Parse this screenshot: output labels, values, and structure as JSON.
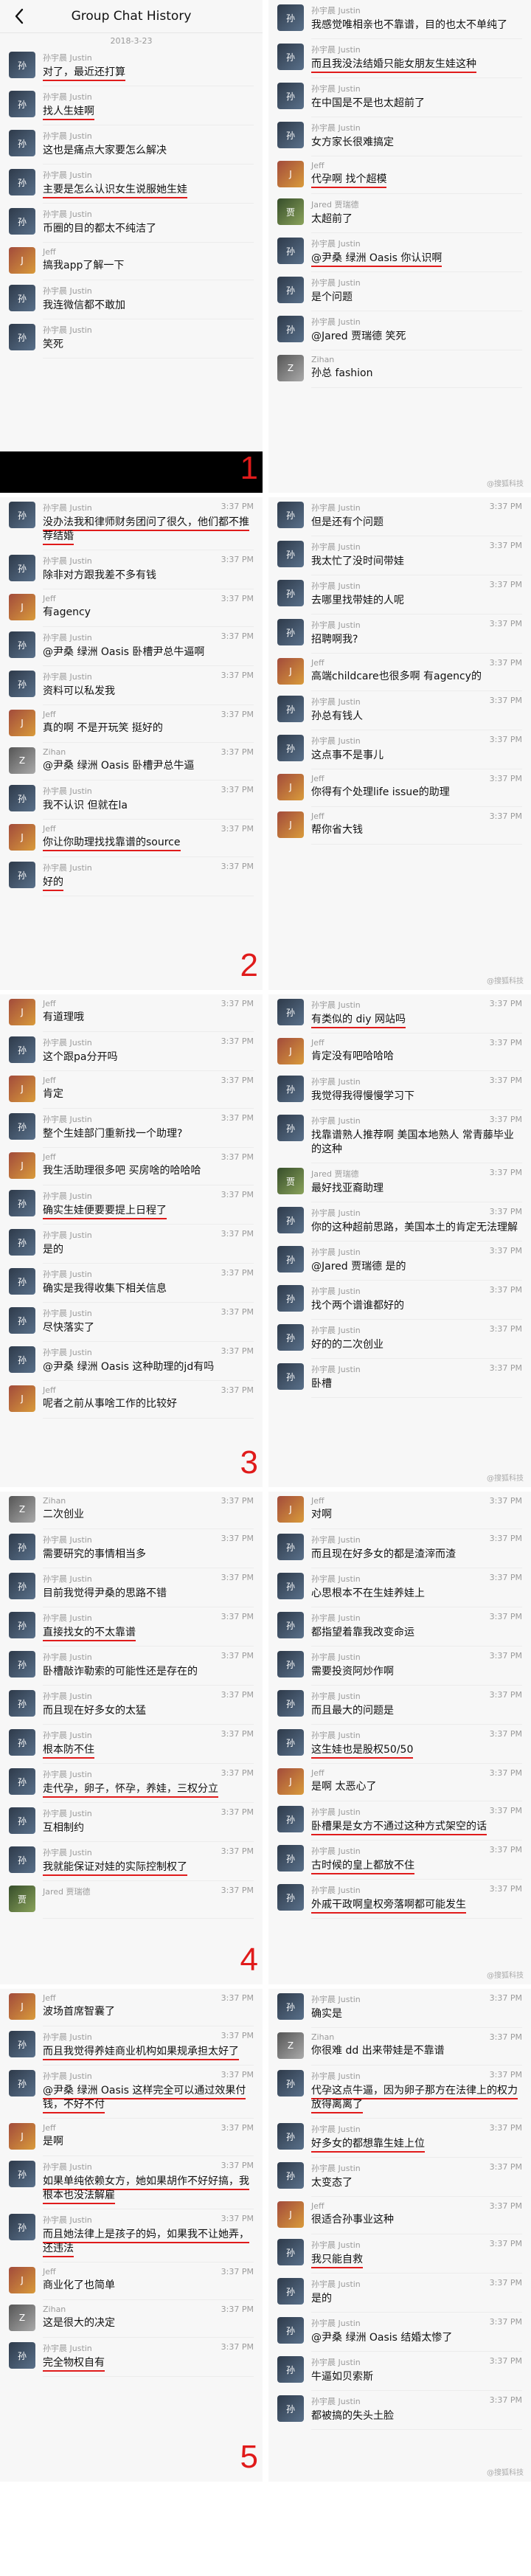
{
  "header": {
    "title": "Group Chat History",
    "date": "2018-3-23",
    "back_icon": "chevron-left-icon"
  },
  "watermark": "@搜狐科技",
  "users": {
    "justin": "孙宇晨 Justin",
    "jeff": "Jeff",
    "zihan": "Zihan",
    "jared": "Jared 贾瑞德",
    "jaredb": "Jared 贾瑞德"
  },
  "left_blocks": [
    {
      "number": "1",
      "show_header": true,
      "black_bar": true,
      "messages": [
        {
          "u": "justin",
          "t": "对了，最近还打算",
          "time": "",
          "ul": true
        },
        {
          "u": "justin",
          "t": "找人生娃啊",
          "time": "",
          "ul": true
        },
        {
          "u": "justin",
          "t": "这也是痛点大家要怎么解决",
          "time": "",
          "ul": false
        },
        {
          "u": "justin",
          "t": "主要是怎么认识女生说服她生娃",
          "time": "",
          "ul": true
        },
        {
          "u": "justin",
          "t": "币圈的目的都太不纯洁了",
          "time": "",
          "ul": false
        },
        {
          "u": "jeff",
          "t": "搞我app了解一下",
          "time": "",
          "ul": false
        },
        {
          "u": "justin",
          "t": "我连微信都不敢加",
          "time": "",
          "ul": false
        },
        {
          "u": "justin",
          "t": "笑死",
          "time": "",
          "ul": false
        }
      ]
    },
    {
      "number": "2",
      "show_header": false,
      "black_bar": false,
      "messages": [
        {
          "u": "justin",
          "t": "没办法我和律师财务团问了很久，他们都不推荐结婚",
          "time": "3:37 PM",
          "ul": true
        },
        {
          "u": "justin",
          "t": "除非对方跟我差不多有钱",
          "time": "3:37 PM",
          "ul": false
        },
        {
          "u": "jeff",
          "t": "有agency",
          "time": "3:37 PM",
          "ul": false
        },
        {
          "u": "justin",
          "t": "@尹桑 绿洲 Oasis 卧槽尹总牛逼啊",
          "time": "3:37 PM",
          "ul": false
        },
        {
          "u": "justin",
          "t": "资料可以私发我",
          "time": "3:37 PM",
          "ul": false
        },
        {
          "u": "jeff",
          "t": "真的啊 不是开玩笑 挺好的",
          "time": "3:37 PM",
          "ul": false
        },
        {
          "u": "zihan",
          "t": "@尹桑 绿洲 Oasis 卧槽尹总牛逼",
          "time": "3:37 PM",
          "ul": false
        },
        {
          "u": "justin",
          "t": "我不认识 但就在la",
          "time": "3:37 PM",
          "ul": false
        },
        {
          "u": "jeff",
          "t": "你让你助理找找靠谱的source",
          "time": "3:37 PM",
          "ul": true
        },
        {
          "u": "justin",
          "t": "好的",
          "time": "3:37 PM",
          "ul": true
        }
      ]
    },
    {
      "number": "3",
      "show_header": false,
      "black_bar": false,
      "messages": [
        {
          "u": "jeff",
          "t": "有道理哦",
          "time": "3:37 PM",
          "ul": false
        },
        {
          "u": "justin",
          "t": "这个跟pa分开吗",
          "time": "3:37 PM",
          "ul": false
        },
        {
          "u": "jeff",
          "t": "肯定",
          "time": "3:37 PM",
          "ul": false
        },
        {
          "u": "justin",
          "t": "整个生娃部门重新找一个助理?",
          "time": "3:37 PM",
          "ul": false
        },
        {
          "u": "jeff",
          "t": "我生活助理很多吧 买房啥的哈哈哈",
          "time": "3:37 PM",
          "ul": false
        },
        {
          "u": "justin",
          "t": "确实生娃便要要提上日程了",
          "time": "3:37 PM",
          "ul": true
        },
        {
          "u": "justin",
          "t": "是的",
          "time": "3:37 PM",
          "ul": false
        },
        {
          "u": "justin",
          "t": "确实是我得收集下相关信息",
          "time": "3:37 PM",
          "ul": false
        },
        {
          "u": "justin",
          "t": "尽快落实了",
          "time": "3:37 PM",
          "ul": false
        },
        {
          "u": "justin",
          "t": "@尹桑 绿洲 Oasis 这种助理的jd有吗",
          "time": "3:37 PM",
          "ul": false
        },
        {
          "u": "jeff",
          "t": "呢者之前从事啥工作的比较好",
          "time": "3:37 PM",
          "ul": false
        }
      ]
    },
    {
      "number": "4",
      "show_header": false,
      "black_bar": false,
      "messages": [
        {
          "u": "zihan",
          "t": "二次创业",
          "time": "3:37 PM",
          "ul": false
        },
        {
          "u": "justin",
          "t": "需要研究的事情相当多",
          "time": "3:37 PM",
          "ul": false
        },
        {
          "u": "justin",
          "t": "目前我觉得尹桑的思路不错",
          "time": "3:37 PM",
          "ul": false
        },
        {
          "u": "justin",
          "t": "直接找女的不太靠谱",
          "time": "3:37 PM",
          "ul": true
        },
        {
          "u": "justin",
          "t": "卧槽敲诈勒索的可能性还是存在的",
          "time": "3:37 PM",
          "ul": false
        },
        {
          "u": "justin",
          "t": "而且现在好多女的太猛",
          "time": "3:37 PM",
          "ul": false
        },
        {
          "u": "justin",
          "t": "根本防不住",
          "time": "3:37 PM",
          "ul": true
        },
        {
          "u": "justin",
          "t": "走代孕，卵子，怀孕，养娃，三权分立",
          "time": "3:37 PM",
          "ul": true
        },
        {
          "u": "justin",
          "t": "互相制约",
          "time": "3:37 PM",
          "ul": false
        },
        {
          "u": "justin",
          "t": "我就能保证对娃的实际控制权了",
          "time": "3:37 PM",
          "ul": true
        },
        {
          "u": "jared",
          "t": "",
          "time": "3:37 PM",
          "ul": false
        }
      ]
    },
    {
      "number": "5",
      "show_header": false,
      "black_bar": false,
      "messages": [
        {
          "u": "jeff",
          "t": "波场首席智囊了",
          "time": "3:37 PM",
          "ul": false
        },
        {
          "u": "justin",
          "t": "而且我觉得养娃商业机构如果规承担太好了",
          "time": "3:37 PM",
          "ul": true
        },
        {
          "u": "justin",
          "t": "@尹桑 绿洲 Oasis 这样完全可以通过效果付钱，不好不付",
          "time": "3:37 PM",
          "ul": true
        },
        {
          "u": "jeff",
          "t": "是啊",
          "time": "3:37 PM",
          "ul": false
        },
        {
          "u": "justin",
          "t": "如果单纯依赖女方，她如果胡作不好好搞，我根本也没法解雇",
          "time": "3:37 PM",
          "ul": true
        },
        {
          "u": "justin",
          "t": "而且她法律上是孩子的妈，如果我不让她弄，还违法",
          "time": "3:37 PM",
          "ul": true
        },
        {
          "u": "jeff",
          "t": "商业化了也简单",
          "time": "3:37 PM",
          "ul": false
        },
        {
          "u": "zihan",
          "t": "这是很大的决定",
          "time": "3:37 PM",
          "ul": false
        },
        {
          "u": "justin",
          "t": "完全物权自有",
          "time": "3:37 PM",
          "ul": true
        }
      ]
    }
  ],
  "right_blocks": [
    {
      "messages": [
        {
          "u": "justin",
          "t": "我感觉唯相亲也不靠谱，目的也太不单纯了",
          "time": "",
          "ul": false
        },
        {
          "u": "justin",
          "t": "而且我没法结婚只能女朋友生娃这种",
          "time": "",
          "ul": true
        },
        {
          "u": "justin",
          "t": "在中国是不是也太超前了",
          "time": "",
          "ul": false
        },
        {
          "u": "justin",
          "t": "女方家长很难搞定",
          "time": "",
          "ul": false
        },
        {
          "u": "jeff",
          "t": "代孕啊 找个超模",
          "time": "",
          "ul": true
        },
        {
          "u": "jared",
          "t": "太超前了",
          "time": "",
          "ul": false
        },
        {
          "u": "justin",
          "t": "@尹桑 绿洲 Oasis 你认识啊",
          "time": "",
          "ul": true
        },
        {
          "u": "justin",
          "t": "是个问题",
          "time": "",
          "ul": false
        },
        {
          "u": "justin",
          "t": "@Jared 贾瑞德 笑死",
          "time": "",
          "ul": false
        },
        {
          "u": "zihan",
          "t": "孙总 fashion",
          "time": "",
          "ul": false
        }
      ]
    },
    {
      "messages": [
        {
          "u": "justin",
          "t": "但是还有个问题",
          "time": "3:37 PM",
          "ul": false
        },
        {
          "u": "justin",
          "t": "我太忙了没时间带娃",
          "time": "3:37 PM",
          "ul": false
        },
        {
          "u": "justin",
          "t": "去哪里找带娃的人呢",
          "time": "3:37 PM",
          "ul": false
        },
        {
          "u": "justin",
          "t": "招聘啊我?",
          "time": "3:37 PM",
          "ul": false
        },
        {
          "u": "jeff",
          "t": "高端childcare也很多啊 有agency的",
          "time": "3:37 PM",
          "ul": false
        },
        {
          "u": "justin",
          "t": "孙总有钱人",
          "time": "3:37 PM",
          "ul": false
        },
        {
          "u": "justin",
          "t": "这点事不是事儿",
          "time": "3:37 PM",
          "ul": false
        },
        {
          "u": "jeff",
          "t": "你得有个处理life issue的助理",
          "time": "3:37 PM",
          "ul": false
        },
        {
          "u": "jeff",
          "t": "帮你省大钱",
          "time": "3:37 PM",
          "ul": false
        }
      ]
    },
    {
      "messages": [
        {
          "u": "justin",
          "t": "有类似的 diy 网站吗",
          "time": "3:37 PM",
          "ul": true
        },
        {
          "u": "jeff",
          "t": "肯定没有吧哈哈哈",
          "time": "3:37 PM",
          "ul": false
        },
        {
          "u": "justin",
          "t": "我觉得我得慢慢学习下",
          "time": "3:37 PM",
          "ul": false
        },
        {
          "u": "justin",
          "t": "找靠谱熟人推荐啊 美国本地熟人 常青藤毕业的这种",
          "time": "3:37 PM",
          "ul": false
        },
        {
          "u": "jared",
          "t": "最好找亚裔助理",
          "time": "3:37 PM",
          "ul": false
        },
        {
          "u": "justin",
          "t": "你的这种超前思路，美国本土的肯定无法理解",
          "time": "3:37 PM",
          "ul": false
        },
        {
          "u": "justin",
          "t": "@Jared 贾瑞德 是的",
          "time": "3:37 PM",
          "ul": false
        },
        {
          "u": "justin",
          "t": "找个两个谱谁都好的",
          "time": "3:37 PM",
          "ul": false
        },
        {
          "u": "justin",
          "t": "好的的二次创业",
          "time": "3:37 PM",
          "ul": false
        },
        {
          "u": "justin",
          "t": "卧槽",
          "time": "3:37 PM",
          "ul": false
        }
      ]
    },
    {
      "messages": [
        {
          "u": "jeff",
          "t": "对啊",
          "time": "3:37 PM",
          "ul": false
        },
        {
          "u": "justin",
          "t": "而且现在好多女的都是渣滓而渣",
          "time": "3:37 PM",
          "ul": false
        },
        {
          "u": "justin",
          "t": "心思根本不在生娃养娃上",
          "time": "3:37 PM",
          "ul": false
        },
        {
          "u": "justin",
          "t": "都指望着靠我改变命运",
          "time": "3:37 PM",
          "ul": false
        },
        {
          "u": "justin",
          "t": "需要投资阿炒作啊",
          "time": "3:37 PM",
          "ul": false
        },
        {
          "u": "justin",
          "t": "而且最大的问题是",
          "time": "3:37 PM",
          "ul": false
        },
        {
          "u": "justin",
          "t": "这生娃也是股权50/50",
          "time": "3:37 PM",
          "ul": true
        },
        {
          "u": "jeff",
          "t": "是啊 太恶心了",
          "time": "3:37 PM",
          "ul": false
        },
        {
          "u": "justin",
          "t": "卧槽果是女方不通过这种方式架空的话",
          "time": "3:37 PM",
          "ul": true
        },
        {
          "u": "justin",
          "t": "古时候的皇上都放不住",
          "time": "3:37 PM",
          "ul": true
        },
        {
          "u": "justin",
          "t": "外戚干政啊皇权旁落啊都可能发生",
          "time": "3:37 PM",
          "ul": true
        }
      ]
    },
    {
      "messages": [
        {
          "u": "justin",
          "t": "确实是",
          "time": "3:37 PM",
          "ul": false
        },
        {
          "u": "zihan",
          "t": "你很难 dd 出来带娃是不靠谱",
          "time": "3:37 PM",
          "ul": false
        },
        {
          "u": "justin",
          "t": "代孕这点牛逼，因为卵子那方在法律上的权力放得离离了",
          "time": "3:37 PM",
          "ul": true
        },
        {
          "u": "justin",
          "t": "好多女的都想靠生娃上位",
          "time": "3:37 PM",
          "ul": true
        },
        {
          "u": "justin",
          "t": "太变态了",
          "time": "3:37 PM",
          "ul": false
        },
        {
          "u": "jeff",
          "t": "很适合孙事业这种",
          "time": "3:37 PM",
          "ul": false
        },
        {
          "u": "justin",
          "t": "我只能自救",
          "time": "3:37 PM",
          "ul": true
        },
        {
          "u": "justin",
          "t": "是的",
          "time": "3:37 PM",
          "ul": false
        },
        {
          "u": "justin",
          "t": "@尹桑 绿洲 Oasis 结婚太惨了",
          "time": "3:37 PM",
          "ul": false
        },
        {
          "u": "justin",
          "t": "牛逼如贝索斯",
          "time": "3:37 PM",
          "ul": false
        },
        {
          "u": "justin",
          "t": "都被搞的失头土脸",
          "time": "3:37 PM",
          "ul": false
        }
      ]
    }
  ]
}
